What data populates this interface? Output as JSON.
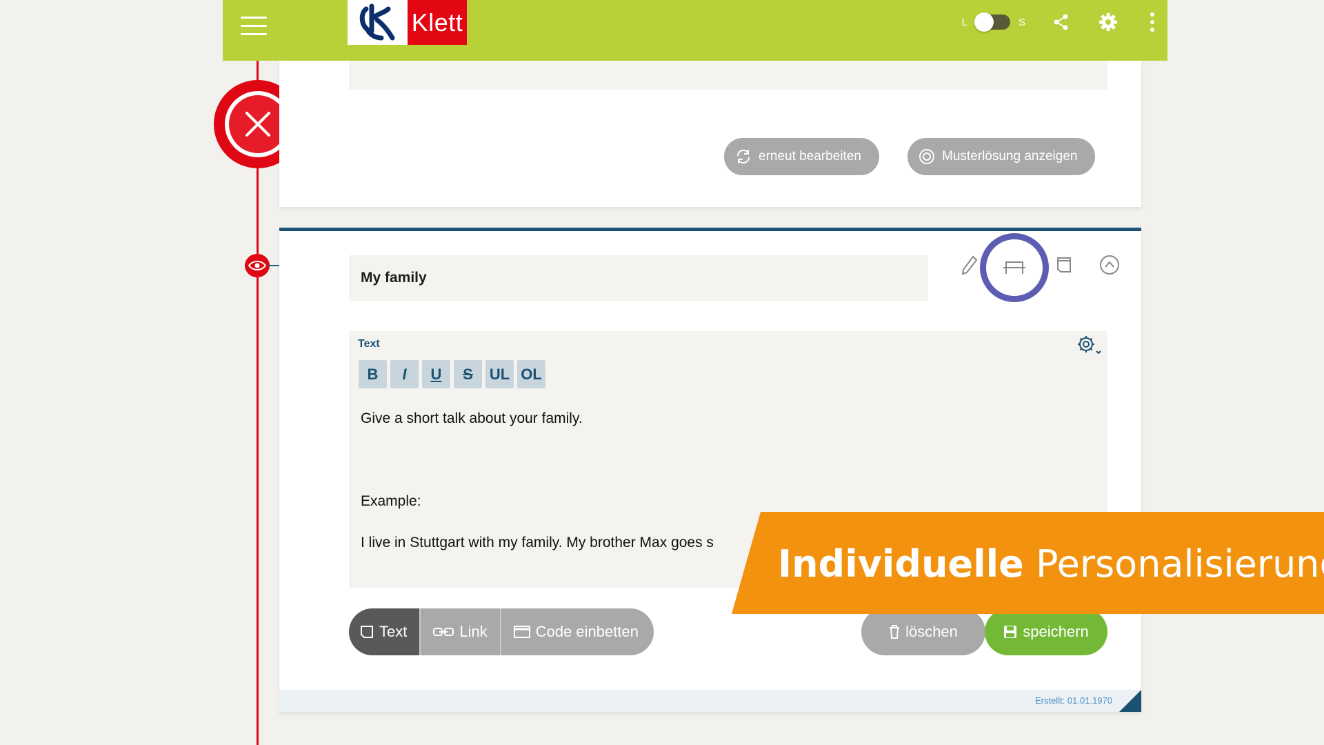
{
  "brand": {
    "name": "Klett"
  },
  "appbar": {
    "switch_left": "L",
    "switch_right": "S",
    "icons": [
      "menu-icon",
      "share-icon",
      "gear-icon",
      "more-vertical-icon"
    ]
  },
  "top_card": {
    "rework_label": "erneut bearbeiten",
    "solution_label": "Musterlösung anzeigen"
  },
  "main_card": {
    "title": "My family",
    "editor": {
      "label": "Text",
      "format_buttons": [
        "B",
        "I",
        "U",
        "S",
        "UL",
        "OL"
      ],
      "lines": [
        "Give a short talk about your family.",
        "Example:",
        "I live in Stuttgart with my family. My brother Max goes s"
      ]
    },
    "tabs": {
      "text": "Text",
      "link": "Link",
      "embed": "Code einbetten"
    },
    "delete_label": "löschen",
    "save_label": "speichern",
    "created": "Erstellt: 01.01.1970"
  },
  "banner": {
    "bold": "Individuelle",
    "regular": "Personalisierung"
  },
  "colors": {
    "appbar": "#b9d138",
    "brand_red": "#e30613",
    "timeline_red": "#e00714",
    "accent_blue": "#1a5172",
    "highlight_ring": "#5d5eb3",
    "save_green": "#74b936",
    "banner_orange": "#f2920e"
  }
}
